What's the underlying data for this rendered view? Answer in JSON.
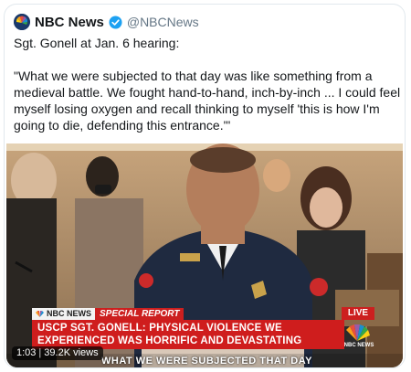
{
  "tweet": {
    "author_name": "NBC News",
    "handle": "@NBCNews",
    "text_lines": [
      "Sgt. Gonell at Jan. 6 hearing:",
      "\"What we were subjected to that day was like something from a medieval battle. We fought hand-to-hand, inch-by-inch ... I could feel myself losing oxygen and recall thinking to myself 'this is how I'm going to die, defending this entrance.'\""
    ]
  },
  "video": {
    "brand_label": "NBC NEWS",
    "special_label": "SPECIAL REPORT",
    "headline_line1": "USCP SGT. GONELL: PHYSICAL VIOLENCE WE",
    "headline_line2": "EXPERIENCED WAS HORRIFIC AND DEVASTATING",
    "live_label": "LIVE",
    "network_caption": "NBC NEWS",
    "subtitle": "WHAT WE WERE SUBJECTED THAT DAY",
    "duration": "1:03",
    "views": "39.2K views"
  },
  "colors": {
    "accent_red": "#cf1d1d",
    "verified_blue": "#1da1f2",
    "nbc_navy": "#1b3a6b"
  }
}
